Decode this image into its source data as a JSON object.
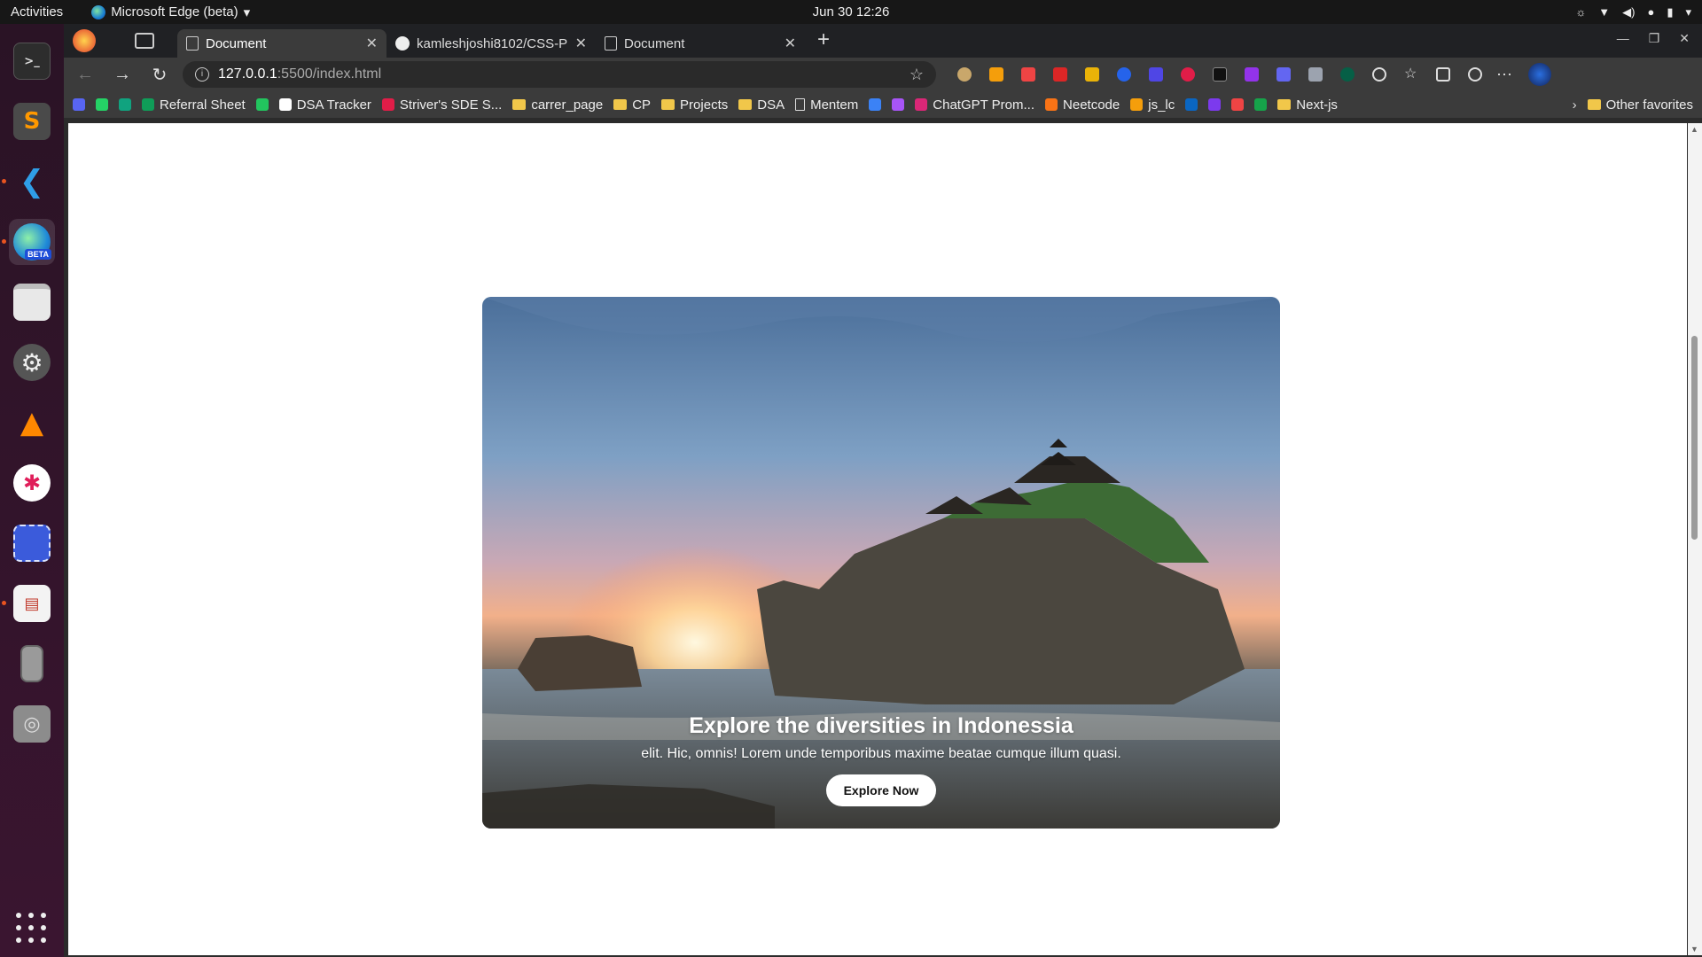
{
  "topbar": {
    "activities": "Activities",
    "app_name": "Microsoft Edge (beta)",
    "clock": "Jun 30  12:26"
  },
  "dock": {
    "items": [
      "terminal-icon",
      "sublime-text-icon",
      "vscode-icon",
      "edge-beta-icon",
      "files-icon",
      "settings-icon",
      "vlc-icon",
      "slack-icon",
      "screenshot-icon",
      "document-viewer-icon",
      "device-icon",
      "disk-icon"
    ],
    "edge_badge": "BETA"
  },
  "tabs": [
    {
      "title": "Document",
      "active": true
    },
    {
      "title": "kamleshjoshi8102/CSS-Pr",
      "active": false
    },
    {
      "title": "Document",
      "active": false
    }
  ],
  "address": {
    "host": "127.0.0.1",
    "path": ":5500/index.html"
  },
  "bookmarks": {
    "items": [
      {
        "label": "",
        "type": "fav",
        "color": "#5865f2"
      },
      {
        "label": "",
        "type": "fav",
        "color": "#25d366"
      },
      {
        "label": "",
        "type": "fav",
        "color": "#10a37f"
      },
      {
        "label": "Referral Sheet",
        "type": "fav",
        "color": "#0f9d58"
      },
      {
        "label": "",
        "type": "fav",
        "color": "#22c55e"
      },
      {
        "label": "DSA Tracker",
        "type": "fav",
        "color": "#ffffff"
      },
      {
        "label": "Striver's SDE S...",
        "type": "fav",
        "color": "#e11d48"
      },
      {
        "label": "carrer_page",
        "type": "folder"
      },
      {
        "label": "CP",
        "type": "folder"
      },
      {
        "label": "Projects",
        "type": "folder"
      },
      {
        "label": "DSA",
        "type": "folder"
      },
      {
        "label": "Mentem",
        "type": "doc"
      },
      {
        "label": "",
        "type": "fav",
        "color": "#3b82f6"
      },
      {
        "label": "",
        "type": "fav",
        "color": "#a855f7"
      },
      {
        "label": "ChatGPT Prom...",
        "type": "fav",
        "color": "#db2777"
      },
      {
        "label": "Neetcode",
        "type": "fav",
        "color": "#f97316"
      },
      {
        "label": "js_lc",
        "type": "fav",
        "color": "#f59e0b"
      },
      {
        "label": "",
        "type": "fav",
        "color": "#0a66c2"
      },
      {
        "label": "",
        "type": "fav",
        "color": "#7c3aed"
      },
      {
        "label": "",
        "type": "fav",
        "color": "#ef4444"
      },
      {
        "label": "",
        "type": "fav",
        "color": "#16a34a"
      },
      {
        "label": "Next-js",
        "type": "folder"
      }
    ],
    "other": "Other favorites"
  },
  "hero": {
    "title": "Explore the diversities in Indonessia",
    "subtitle": "elit. Hic, omnis! Lorem unde temporibus maxime beatae cumque illum quasi.",
    "button": "Explore Now"
  }
}
